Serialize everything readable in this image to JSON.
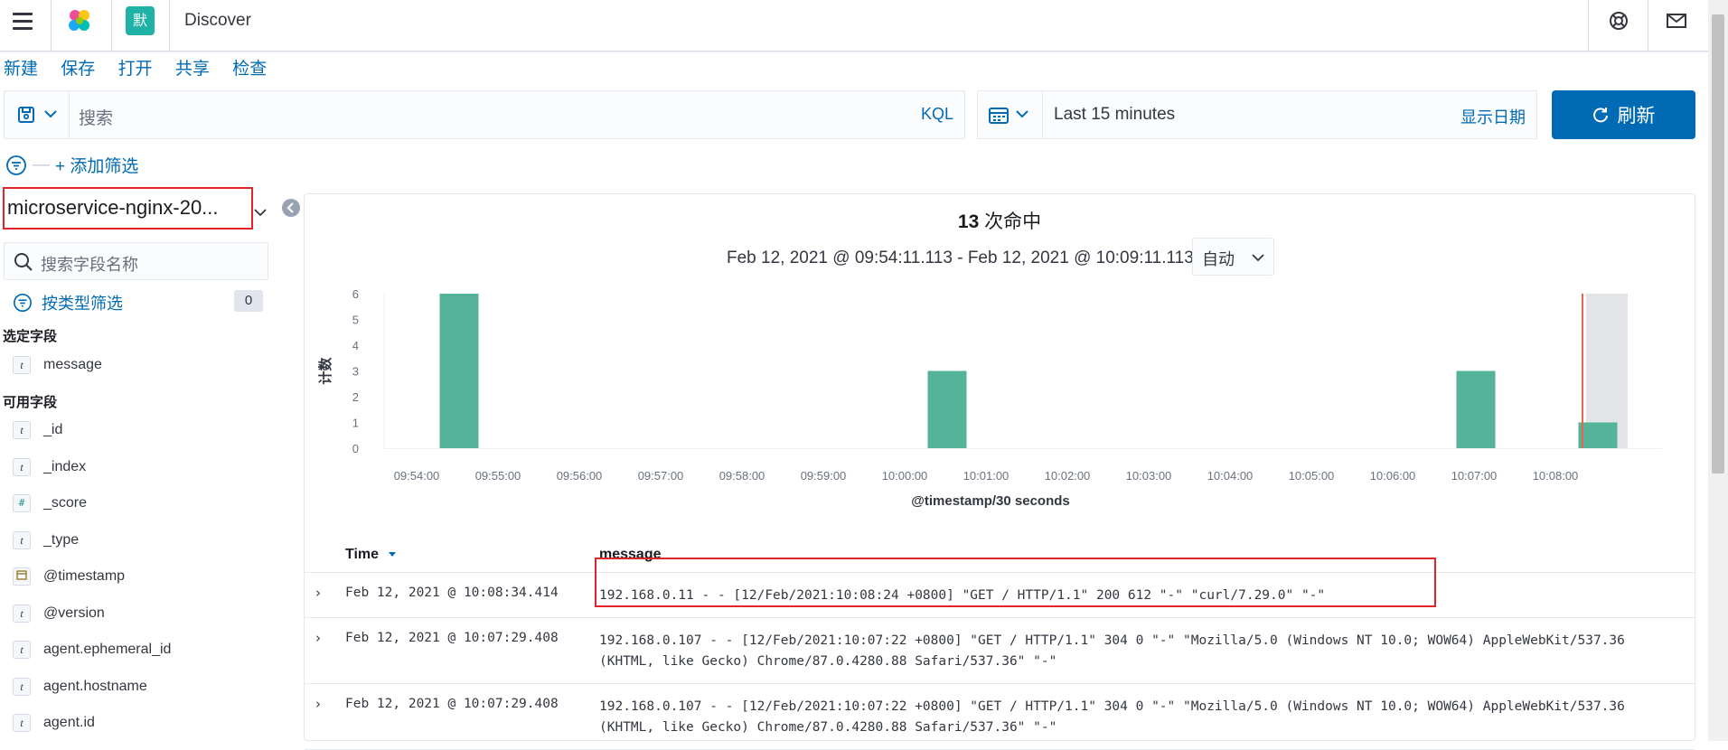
{
  "header": {
    "app_title": "Discover",
    "space_letter": "默"
  },
  "menu": {
    "items": [
      "新建",
      "保存",
      "打开",
      "共享",
      "检查"
    ]
  },
  "query": {
    "placeholder": "搜索",
    "language": "KQL"
  },
  "time": {
    "range": "Last 15 minutes",
    "show_dates": "显示日期",
    "refresh": "刷新"
  },
  "filters": {
    "add_label": "+ 添加筛选"
  },
  "sidebar": {
    "index_pattern": "microservice-nginx-20...",
    "field_search_placeholder": "搜索字段名称",
    "type_filter_label": "按类型筛选",
    "type_filter_count": "0",
    "selected_title": "选定字段",
    "selected_fields": [
      {
        "type": "t",
        "name": "message"
      }
    ],
    "available_title": "可用字段",
    "available_fields": [
      {
        "type": "t",
        "name": "_id"
      },
      {
        "type": "t",
        "name": "_index"
      },
      {
        "type": "#",
        "name": "_score"
      },
      {
        "type": "t",
        "name": "_type"
      },
      {
        "type": "date",
        "name": "@timestamp"
      },
      {
        "type": "t",
        "name": "@version"
      },
      {
        "type": "t",
        "name": "agent.ephemeral_id"
      },
      {
        "type": "t",
        "name": "agent.hostname"
      },
      {
        "type": "t",
        "name": "agent.id"
      }
    ]
  },
  "main": {
    "hits_count": "13",
    "hits_label": " 次命中",
    "date_range": "Feb 12, 2021 @ 09:54:11.113 - Feb 12, 2021 @ 10:09:11.113",
    "interval": "自动",
    "table": {
      "col_time": "Time",
      "col_message": "message",
      "rows": [
        {
          "time": "Feb 12, 2021 @ 10:08:34.414",
          "message": "192.168.0.11 - - [12/Feb/2021:10:08:24 +0800] \"GET / HTTP/1.1\" 200 612 \"-\" \"curl/7.29.0\" \"-\""
        },
        {
          "time": "Feb 12, 2021 @ 10:07:29.408",
          "message": "192.168.0.107 - - [12/Feb/2021:10:07:22 +0800] \"GET / HTTP/1.1\" 304 0 \"-\" \"Mozilla/5.0 (Windows NT 10.0; WOW64) AppleWebKit/537.36 (KHTML, like Gecko) Chrome/87.0.4280.88 Safari/537.36\" \"-\""
        },
        {
          "time": "Feb 12, 2021 @ 10:07:29.408",
          "message": "192.168.0.107 - - [12/Feb/2021:10:07:22 +0800] \"GET / HTTP/1.1\" 304 0 \"-\" \"Mozilla/5.0 (Windows NT 10.0; WOW64) AppleWebKit/537.36 (KHTML, like Gecko) Chrome/87.0.4280.88 Safari/537.36\" \"-\""
        }
      ]
    }
  },
  "chart_data": {
    "type": "bar",
    "ylabel": "计数",
    "xlabel": "@timestamp/30 seconds",
    "ylim": [
      0,
      6
    ],
    "yticks": [
      0,
      1,
      2,
      3,
      4,
      5,
      6
    ],
    "xticks": [
      "09:54:00",
      "09:55:00",
      "09:56:00",
      "09:57:00",
      "09:58:00",
      "09:59:00",
      "10:00:00",
      "10:01:00",
      "10:02:00",
      "10:03:00",
      "10:04:00",
      "10:05:00",
      "10:06:00",
      "10:07:00",
      "10:08:00"
    ],
    "bars": [
      {
        "x": "09:54:30",
        "value": 6
      },
      {
        "x": "10:00:30",
        "value": 3
      },
      {
        "x": "10:07:00",
        "value": 3
      },
      {
        "x": "10:08:30",
        "value": 1
      }
    ],
    "bar_color": "#54b399",
    "now_marker": "10:08:30"
  }
}
